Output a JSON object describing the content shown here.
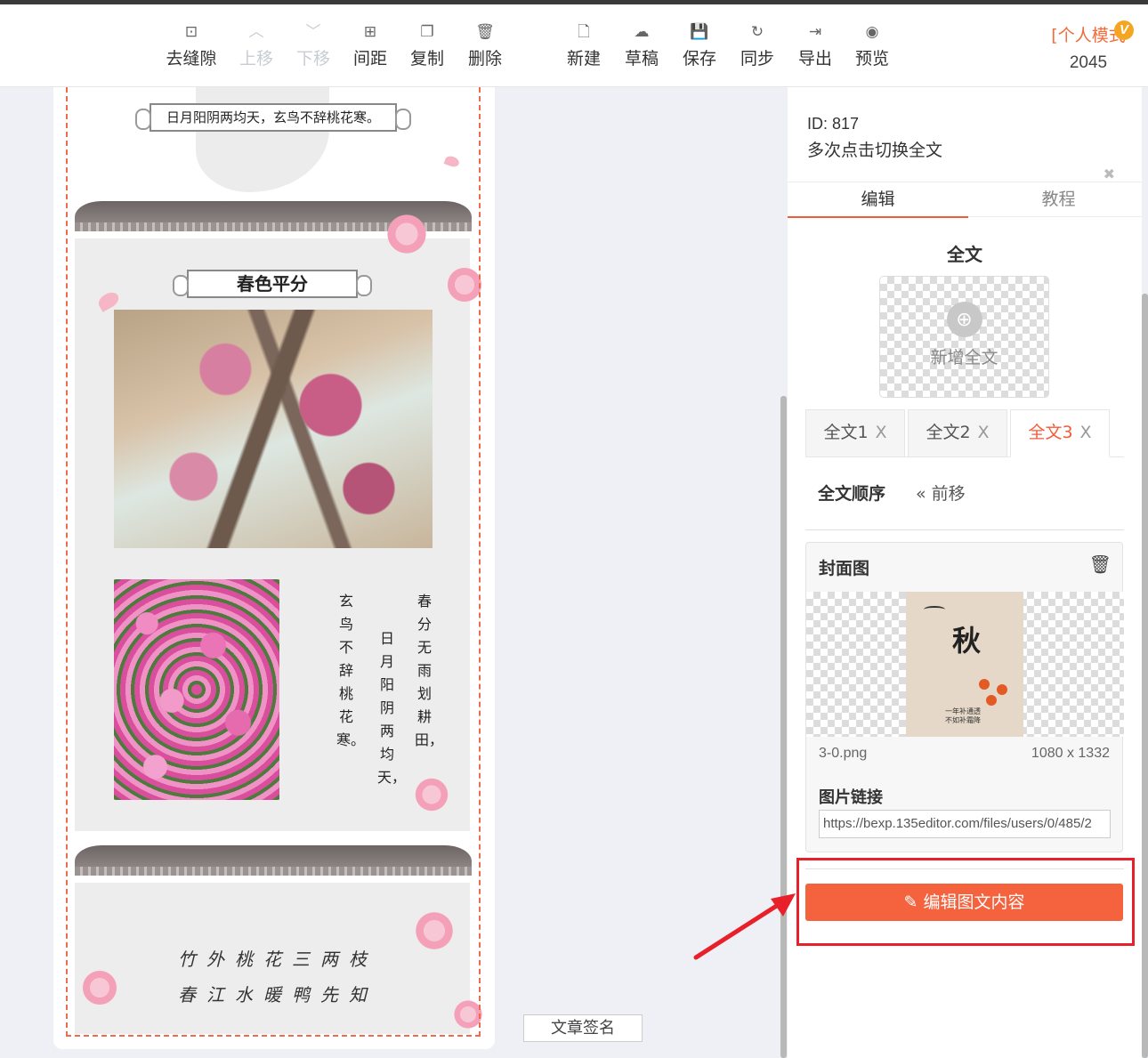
{
  "toolbar": {
    "items": [
      {
        "label": "去缝隙",
        "icon": "gap-icon"
      },
      {
        "label": "上移",
        "icon": "arrow-up-icon"
      },
      {
        "label": "下移",
        "icon": "arrow-down-icon"
      },
      {
        "label": "间距",
        "icon": "spacing-icon"
      },
      {
        "label": "复制",
        "icon": "copy-icon"
      },
      {
        "label": "删除",
        "icon": "trash-icon"
      },
      {
        "label": "新建",
        "icon": "new-file-icon"
      },
      {
        "label": "草稿",
        "icon": "cloud-icon"
      },
      {
        "label": "保存",
        "icon": "save-icon"
      },
      {
        "label": "同步",
        "icon": "sync-icon"
      },
      {
        "label": "导出",
        "icon": "export-icon"
      },
      {
        "label": "预览",
        "icon": "eye-icon"
      }
    ],
    "mode_label": "[个人模式",
    "mode_badge": "V",
    "mode_number": "2045"
  },
  "canvas": {
    "top_caption": "日月阳阴两均天，玄鸟不辞桃花寒。",
    "section_title": "春色平分",
    "vertical_col1": "春分无雨划耕田，",
    "vertical_col2": "日月阳阴两均天，",
    "vertical_col3": "玄鸟不辞桃花寒。",
    "line1": "竹外桃花三两枝",
    "line2": "春江水暖鸭先知"
  },
  "sign_button": "文章签名",
  "panel": {
    "id_text": "ID: 817",
    "hint": "多次点击切换全文",
    "tabs": [
      "编辑",
      "教程"
    ],
    "section_title": "全文",
    "add_label": "新增全文",
    "full_tabs": [
      "全文1",
      "全文2",
      "全文3"
    ],
    "close_mark": "X",
    "order_label": "全文顺序",
    "prev_label": "前移",
    "cover": {
      "title": "封面图",
      "big_char": "秋",
      "poster_line1": "一年补通透",
      "poster_line2": "不如补霜降",
      "file_name": "3-0.png",
      "file_size": "1080 x 1332",
      "link_label": "图片链接",
      "link_value": "https://bexp.135editor.com/files/users/0/485/2"
    },
    "edit_button": "编辑图文内容"
  },
  "colors": {
    "accent": "#f4623e",
    "highlight": "#e8202a",
    "mode": "#f26b3a"
  }
}
